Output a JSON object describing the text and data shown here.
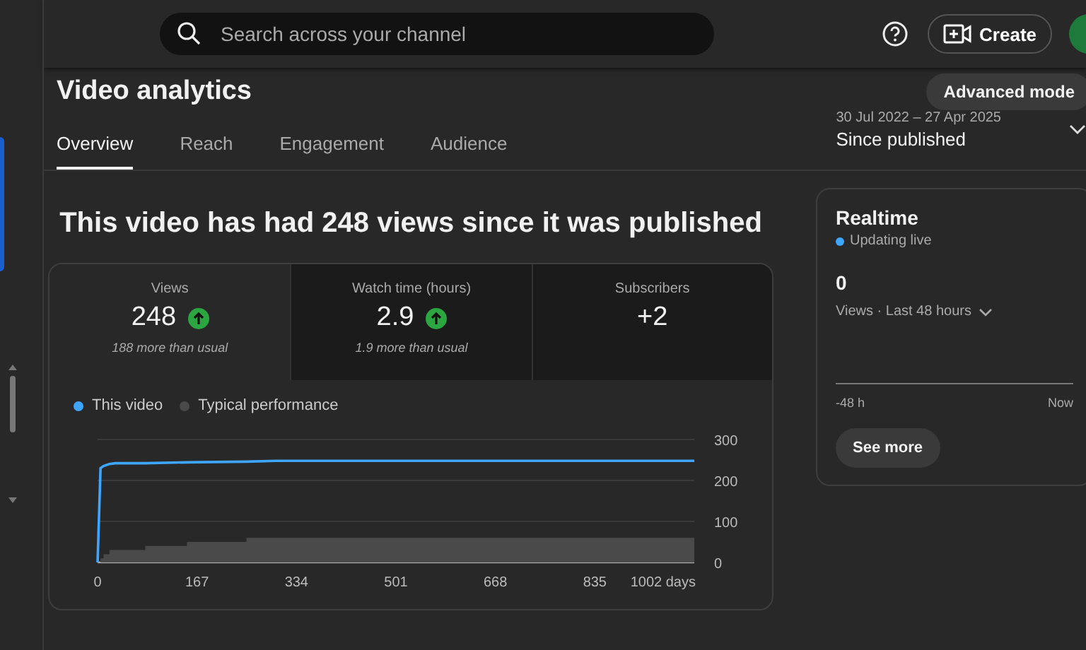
{
  "header": {
    "search": {
      "placeholder": "Search across your channel"
    },
    "create_label": "Create"
  },
  "page": {
    "title": "Video analytics",
    "advanced_button": "Advanced mode",
    "tabs": [
      {
        "label": "Overview",
        "selected": true
      },
      {
        "label": "Reach",
        "selected": false
      },
      {
        "label": "Engagement",
        "selected": false
      },
      {
        "label": "Audience",
        "selected": false
      }
    ],
    "date_range": {
      "dates": "30 Jul 2022 – 27 Apr 2025",
      "period": "Since published"
    }
  },
  "headline": "This video has had 248 views since it was published",
  "metrics": [
    {
      "label": "Views",
      "value": "248",
      "trend_up": true,
      "note": "188 more than usual",
      "selected": true
    },
    {
      "label": "Watch time (hours)",
      "value": "2.9",
      "trend_up": true,
      "note": "1.9 more than usual",
      "selected": false
    },
    {
      "label": "Subscribers",
      "value": "+2",
      "trend_up": false,
      "selected": false
    }
  ],
  "chart": {
    "chart_data": {
      "type": "line",
      "x": [
        0,
        5,
        10,
        20,
        30,
        80,
        150,
        250,
        300,
        1002
      ],
      "xlim": [
        0,
        1002
      ],
      "ylim": [
        0,
        300
      ],
      "xticks": [
        0,
        167,
        334,
        501,
        668,
        835,
        {
          "value": 1002,
          "label": "1002 days"
        }
      ],
      "yticks": [
        0,
        100,
        200,
        300
      ],
      "series": [
        {
          "name": "This video",
          "color": "#3ea6ff",
          "values": [
            0,
            230,
            235,
            240,
            242,
            242,
            244,
            246,
            248,
            248
          ]
        },
        {
          "name": "Typical performance",
          "type": "area",
          "color": "#4a4a4a",
          "values": [
            0,
            10,
            20,
            30,
            30,
            40,
            50,
            60,
            60,
            60
          ]
        }
      ]
    }
  },
  "realtime": {
    "title": "Realtime",
    "status": {
      "label": "Updating live",
      "color": "#3ea6ff"
    },
    "count": "0",
    "metric": "Views · Last 48 hours",
    "start_label": "-48 h",
    "end_label": "Now",
    "button": "See more"
  }
}
